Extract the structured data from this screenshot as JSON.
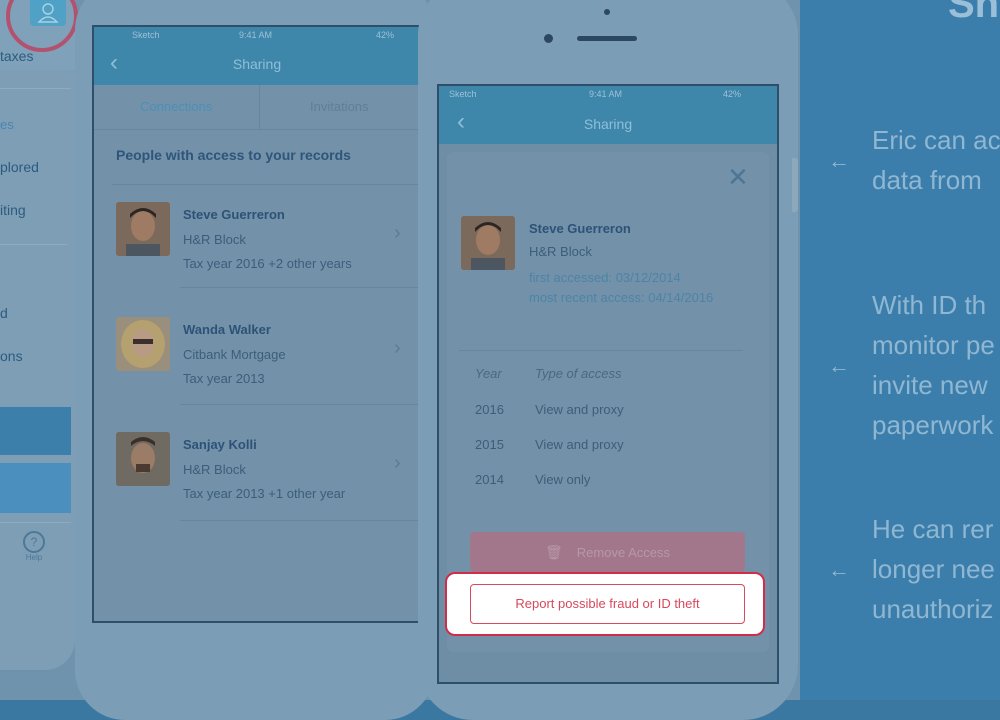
{
  "colors": {
    "dim_overlay": "#6f93ad",
    "right_panel": "#3c7eab",
    "highlight": "#cf2d4a",
    "nav_bar": "#3f86ab"
  },
  "left_phone": {
    "menu": [
      "taxes",
      "es",
      "plored",
      "iting",
      "d",
      "ons"
    ],
    "help_label": "Help"
  },
  "connections_screen": {
    "status": {
      "carrier": "Sketch",
      "time": "9:41 AM",
      "battery": "42%"
    },
    "nav_title": "Sharing",
    "tabs": [
      "Connections",
      "Invitations"
    ],
    "heading": "People with access to your records",
    "people": [
      {
        "name": "Steve Guerreron",
        "company": "H&R Block",
        "years": "Tax year 2016  +2 other years"
      },
      {
        "name": "Wanda Walker",
        "company": "Citbank Mortgage",
        "years": "Tax year 2013"
      },
      {
        "name": "Sanjay Kolli",
        "company": "H&R Block",
        "years": "Tax year 2013  +1 other year"
      }
    ]
  },
  "detail_screen": {
    "status": {
      "carrier": "Sketch",
      "time": "9:41 AM",
      "battery": "42%"
    },
    "nav_title": "Sharing",
    "name": "Steve Guerreron",
    "company": "H&R Block",
    "first_accessed": "first accessed:  03/12/2014",
    "recent_access": "most recent access:  04/14/2016",
    "table_headers": [
      "Year",
      "Type of access"
    ],
    "rows": [
      {
        "year": "2016",
        "type": "View and proxy"
      },
      {
        "year": "2015",
        "type": "View and proxy"
      },
      {
        "year": "2014",
        "type": "View only"
      }
    ],
    "remove_label": "Remove Access",
    "report_label": "Report possible fraud or ID theft"
  },
  "right_panel": {
    "title": "Sh",
    "bullets": [
      [
        "Eric can ac",
        "data from"
      ],
      [
        "With ID th",
        "monitor pe",
        "invite new",
        "paperwork"
      ],
      [
        "He can rer",
        "longer nee",
        "unauthoriz"
      ]
    ]
  }
}
